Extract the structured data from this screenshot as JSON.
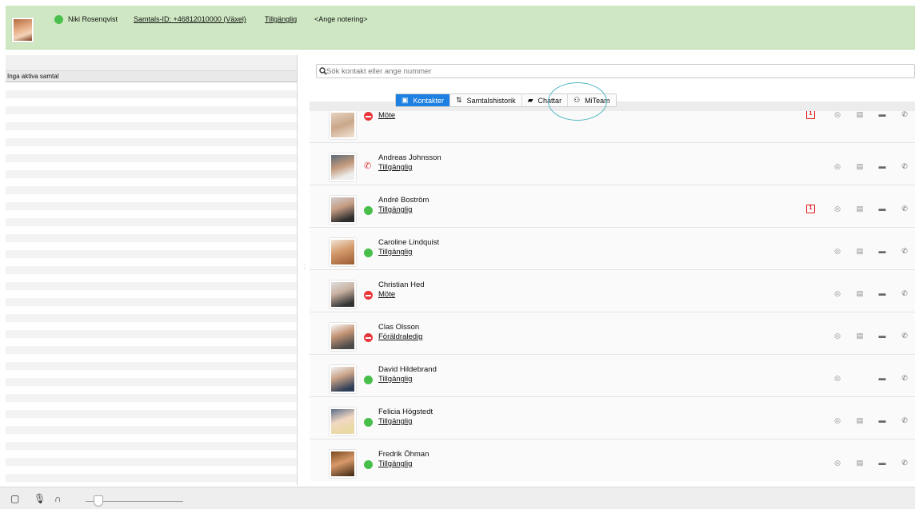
{
  "header": {
    "user_name": "Niki Rosenqvist",
    "call_id": "Samtals-ID: +46812010000 (Växel)",
    "availability": "Tillgänglig",
    "note": "<Ange notering>",
    "status_color": "#49c04c"
  },
  "left": {
    "calls_header": "Inga aktiva samtal"
  },
  "search": {
    "placeholder": "Sök kontakt eller ange nummer"
  },
  "tabs": [
    {
      "label": "Kontakter",
      "icon": "contacts-icon",
      "active": true
    },
    {
      "label": "Samtalshistorik",
      "icon": "history-icon",
      "active": false
    },
    {
      "label": "Chattar",
      "icon": "chat-bubble-icon",
      "active": false
    },
    {
      "label": "MiTeam",
      "icon": "team-icon",
      "active": false
    }
  ],
  "contacts": [
    {
      "name": "",
      "status": "Möte",
      "status_icon": "red",
      "calendar": true,
      "note_icon": true
    },
    {
      "name": "Andreas Johnsson",
      "status": "Tillgänglig",
      "status_icon": "phone",
      "calendar": false,
      "note_icon": true
    },
    {
      "name": "André Boström",
      "status": "Tillgänglig",
      "status_icon": "green",
      "calendar": true,
      "note_icon": true
    },
    {
      "name": "Caroline Lindquist",
      "status": "Tillgänglig",
      "status_icon": "green",
      "calendar": false,
      "note_icon": true
    },
    {
      "name": "Christian Hed",
      "status": "Möte",
      "status_icon": "red",
      "calendar": false,
      "note_icon": true
    },
    {
      "name": "Clas Olsson",
      "status": "Föräldraledig",
      "status_icon": "red",
      "calendar": false,
      "note_icon": true
    },
    {
      "name": "David Hildebrand",
      "status": "Tillgänglig",
      "status_icon": "green",
      "calendar": false,
      "note_icon": false
    },
    {
      "name": "Felicia Högstedt",
      "status": "Tillgänglig",
      "status_icon": "green",
      "calendar": false,
      "note_icon": true
    },
    {
      "name": "Fredrik Öhman",
      "status": "Tillgänglig",
      "status_icon": "green",
      "calendar": false,
      "note_icon": true
    }
  ],
  "bottom": {
    "icons": [
      "dialpad-icon",
      "microphone-icon",
      "headset-icon"
    ],
    "volume_level": 0.08
  }
}
